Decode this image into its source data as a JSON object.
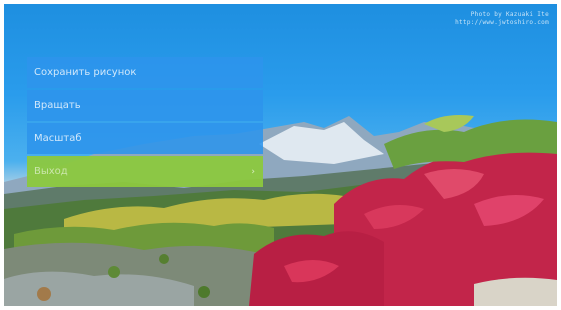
{
  "watermark": {
    "line1": "Photo by Kazuaki Ite",
    "line2": "http://www.jwtoshiro.com"
  },
  "menu": {
    "items": [
      {
        "label": "Сохранить рисунок",
        "selected": false
      },
      {
        "label": "Вращать",
        "selected": false
      },
      {
        "label": "Масштаб",
        "selected": false
      },
      {
        "label": "Выход",
        "selected": true
      }
    ],
    "arrow": "›"
  },
  "colors": {
    "menu_item": "#2d94ec",
    "menu_selected": "#8cc83e",
    "sky": "#2a9cec"
  },
  "icons": [
    "chevron-right-icon"
  ]
}
